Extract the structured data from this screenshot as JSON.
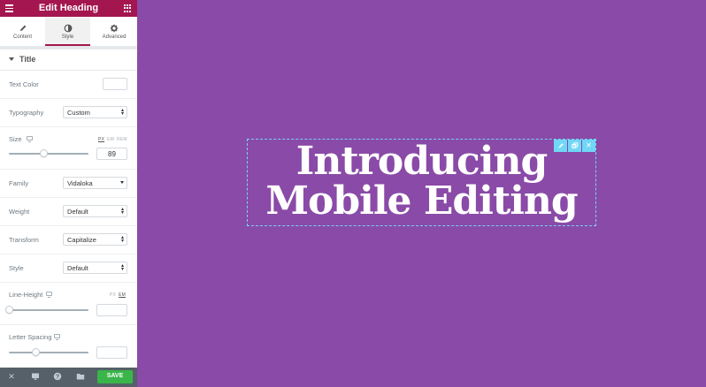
{
  "panel": {
    "title": "Edit Heading",
    "tabs": [
      {
        "label": "Content",
        "icon": "pencil-icon"
      },
      {
        "label": "Style",
        "icon": "contrast-icon"
      },
      {
        "label": "Advanced",
        "icon": "gear-icon"
      }
    ],
    "active_tab": "Style",
    "section": {
      "title": "Title"
    },
    "controls": {
      "text_color": {
        "label": "Text Color"
      },
      "typography": {
        "label": "Typography",
        "value": "Custom"
      },
      "size": {
        "label": "Size",
        "units": [
          "PX",
          "EM",
          "REM"
        ],
        "active_unit": "PX",
        "value": "89",
        "slider_fraction": 0.44
      },
      "family": {
        "label": "Family",
        "value": "Vidaloka"
      },
      "weight": {
        "label": "Weight",
        "value": "Default"
      },
      "transform": {
        "label": "Transform",
        "value": "Capitalize"
      },
      "style": {
        "label": "Style",
        "value": "Default"
      },
      "line_height": {
        "label": "Line-Height",
        "units": [
          "PX",
          "EM"
        ],
        "active_unit": "EM",
        "value": "",
        "slider_fraction": 0.0
      },
      "letter_spacing": {
        "label": "Letter Spacing",
        "value": "",
        "slider_fraction": 0.34
      }
    },
    "footer": {
      "icons": [
        "close-icon",
        "desktop-icon",
        "help-icon",
        "folder-icon"
      ],
      "save_label": "SAVE"
    }
  },
  "canvas": {
    "heading_line1": "Introducing",
    "heading_line2": "Mobile Editing",
    "toolbar_icons": [
      "edit-icon",
      "duplicate-icon",
      "remove-icon"
    ]
  },
  "colors": {
    "header": "#a4164f",
    "canvas_background": "#8a4aa7",
    "save_button": "#39b54a",
    "selection_outline": "#71d7f7"
  }
}
